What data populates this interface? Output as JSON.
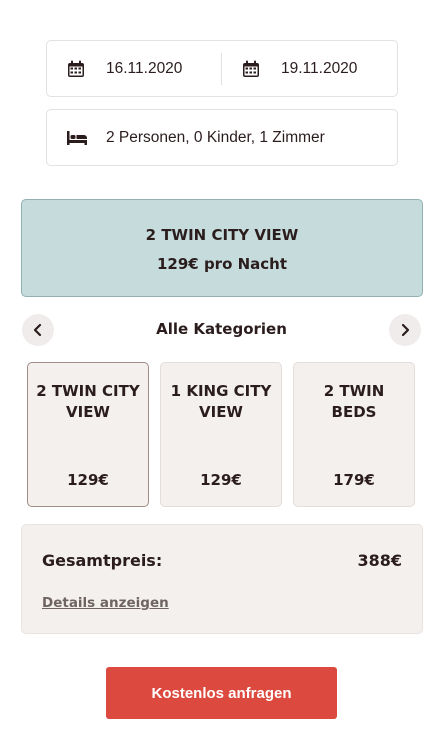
{
  "search": {
    "date_from": "16.11.2020",
    "date_to": "19.11.2020",
    "guests": "2 Personen, 0 Kinder, 1 Zimmer"
  },
  "selected_room": {
    "name": "2 TWIN CITY VIEW",
    "price": "129€ pro Nacht"
  },
  "categories": {
    "title": "Alle Kategorien",
    "items": [
      {
        "name": "2 TWIN CITY VIEW",
        "price": "129€",
        "active": true
      },
      {
        "name": "1 KING CITY VIEW",
        "price": "129€",
        "active": false
      },
      {
        "name": "2 TWIN BEDS",
        "price": "179€",
        "active": false
      }
    ]
  },
  "summary": {
    "total_label": "Gesamtpreis:",
    "total_value": "388€",
    "details_link": "Details anzeigen"
  },
  "cta": {
    "label": "Kostenlos anfragen"
  },
  "colors": {
    "accent": "#dc4a3f",
    "selected_bg": "#c6dcdc",
    "card_bg": "#f4f0ee",
    "text": "#2b1d1d"
  },
  "icons": {
    "calendar": "calendar-icon",
    "bed": "bed-icon",
    "prev": "chevron-left-icon",
    "next": "chevron-right-icon"
  }
}
